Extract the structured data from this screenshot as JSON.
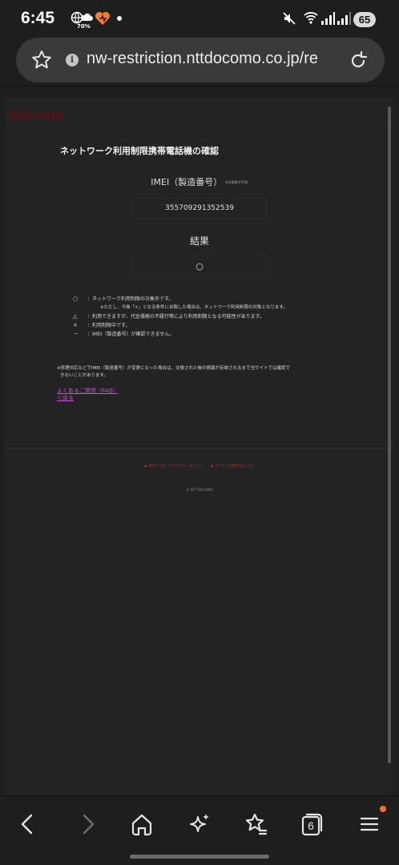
{
  "status_bar": {
    "time": "6:45",
    "weather_percent": "70%",
    "battery": "65"
  },
  "browser": {
    "url": "nw-restriction.nttdocomo.co.jp/re",
    "tab_count": "6"
  },
  "page": {
    "brand": "docomo",
    "title": "ネットワーク利用制限携帯電話機の確認",
    "imei_label": "IMEI（製造番号）",
    "imei_label_note": "※半角数字15桁",
    "imei_value": "355709291352539",
    "result_label": "結果",
    "result_value": "○",
    "legend": [
      {
        "mark": "○",
        "text": "：ネットワーク利用制限の対象外です。"
      },
      {
        "mark": "",
        "text": "※ただし、今後「×」となる条件に合致した場合は、ネットワーク利用制限の対象となります。"
      },
      {
        "mark": "△",
        "text": "：利用できますが、代金債務の不履行等により利用制限となる可能性があります。"
      },
      {
        "mark": "×",
        "text": "：利用制限中です。"
      },
      {
        "mark": "－",
        "text": "：IMEI（製造番号）が確認できません。"
      }
    ],
    "note_line1": "※修理対応などでIMEI（製造番号）が変更になった場合は、交換された後の情報が反映されるまで当サイトでは確認で",
    "note_line2": "きないことがあります。",
    "link_faq": "よくあるご質問（FAQ）",
    "link_back": "＜戻る",
    "footer_link_privacy": "▶ NTTドコモ プライバシーポリシー",
    "footer_link_terms": "▶ サイトご利用にあたって",
    "copyright": "© NTT DOCOMO"
  },
  "colors": {
    "background": "#232323",
    "link": "#c94fd8",
    "brand": "#5c1010",
    "footer_link": "#bb2f3a",
    "badge": "#ff6a2a"
  },
  "icons": {
    "nav": [
      "back-icon",
      "forward-icon",
      "home-icon",
      "sparkle-icon",
      "bookmarks-icon",
      "tabs-icon",
      "menu-icon"
    ]
  }
}
